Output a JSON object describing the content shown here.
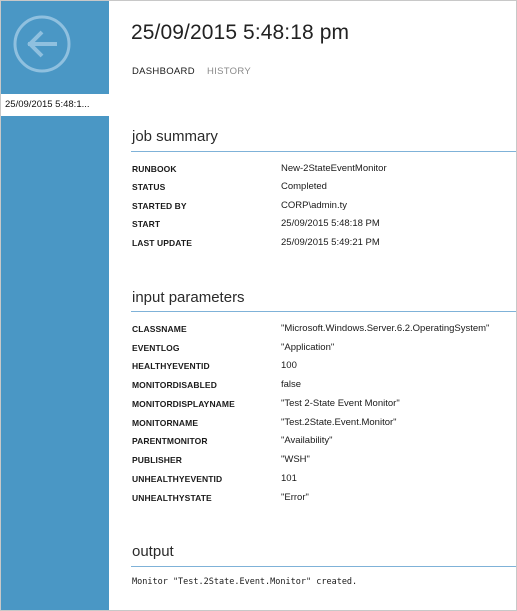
{
  "nav": {
    "back_icon": "back-arrow-circle-icon",
    "sidebar_item_label": "25/09/2015 5:48:1..."
  },
  "header": {
    "title": "25/09/2015 5:48:18 pm",
    "tabs": [
      {
        "label": "DASHBOARD",
        "active": true
      },
      {
        "label": "HISTORY",
        "active": false
      }
    ]
  },
  "job_summary": {
    "heading": "job summary",
    "rows": [
      {
        "label": "RUNBOOK",
        "value": "New-2StateEventMonitor"
      },
      {
        "label": "STATUS",
        "value": "Completed"
      },
      {
        "label": "STARTED BY",
        "value": "CORP\\admin.ty"
      },
      {
        "label": "START",
        "value": "25/09/2015 5:48:18 PM"
      },
      {
        "label": "LAST UPDATE",
        "value": "25/09/2015 5:49:21 PM"
      }
    ]
  },
  "input_parameters": {
    "heading": "input parameters",
    "rows": [
      {
        "label": "CLASSNAME",
        "value": "\"Microsoft.Windows.Server.6.2.OperatingSystem\""
      },
      {
        "label": "EVENTLOG",
        "value": "\"Application\""
      },
      {
        "label": "HEALTHYEVENTID",
        "value": "100"
      },
      {
        "label": "MONITORDISABLED",
        "value": "false"
      },
      {
        "label": "MONITORDISPLAYNAME",
        "value": "\"Test 2-State Event Monitor\""
      },
      {
        "label": "MONITORNAME",
        "value": "\"Test.2State.Event.Monitor\""
      },
      {
        "label": "PARENTMONITOR",
        "value": "\"Availability\""
      },
      {
        "label": "PUBLISHER",
        "value": "\"WSH\""
      },
      {
        "label": "UNHEALTHYEVENTID",
        "value": "101"
      },
      {
        "label": "UNHEALTHYSTATE",
        "value": "\"Error\""
      }
    ]
  },
  "output": {
    "heading": "output",
    "text": "Monitor \"Test.2State.Event.Monitor\" created."
  },
  "colors": {
    "sidebar": "#4a97c5",
    "accent_rule": "#7fb2d8",
    "text": "#1a1a1a",
    "muted_tab": "#8a8a8a"
  }
}
